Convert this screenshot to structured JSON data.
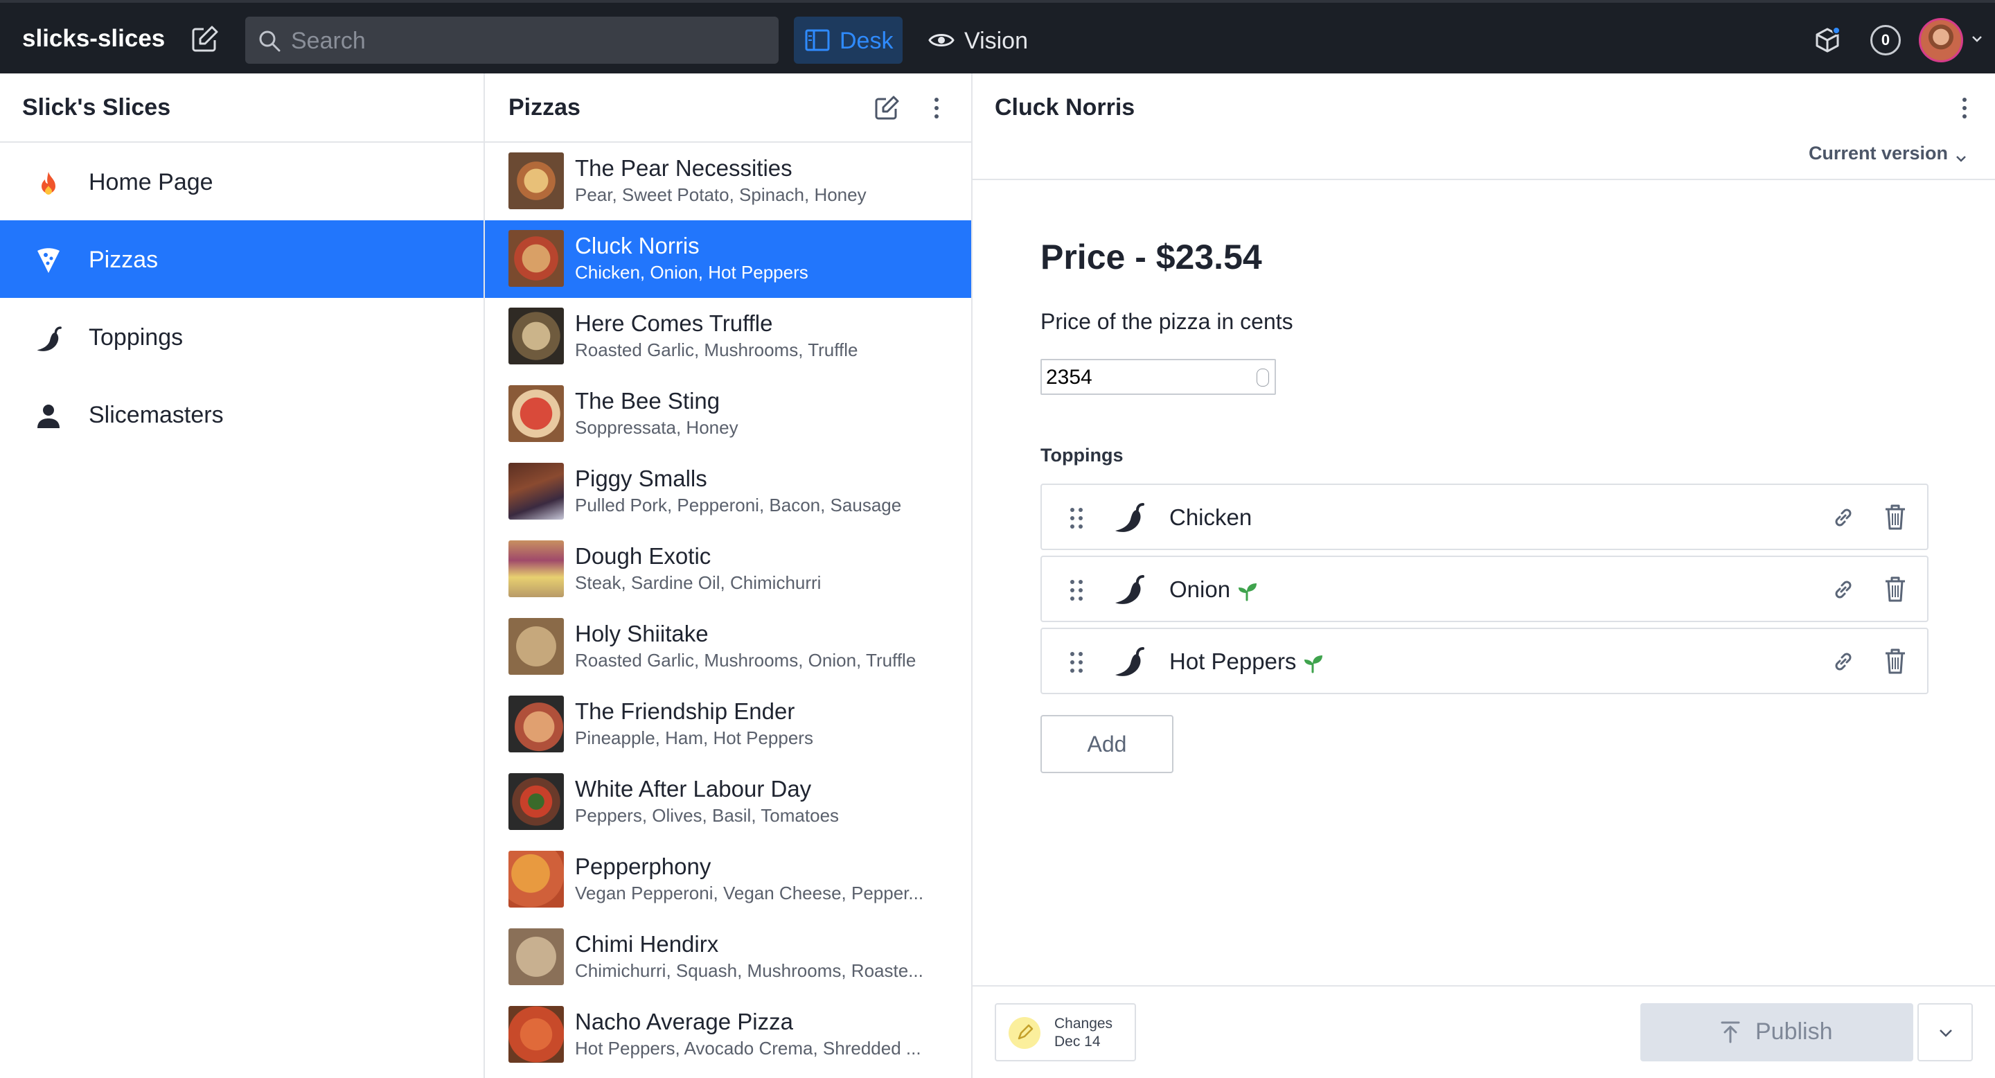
{
  "app": {
    "brand": "slicks-slices",
    "search_placeholder": "Search",
    "tabs": [
      {
        "label": "Desk",
        "active": true
      },
      {
        "label": "Vision",
        "active": false
      }
    ],
    "notification_count": "0",
    "colors": {
      "topbar": "#1b1f26",
      "accent": "#2276fc"
    }
  },
  "structure": {
    "title": "Slick's Slices",
    "items": [
      {
        "label": "Home Page",
        "icon": "fire-icon"
      },
      {
        "label": "Pizzas",
        "icon": "pizza-icon"
      },
      {
        "label": "Toppings",
        "icon": "chili-icon"
      },
      {
        "label": "Slicemasters",
        "icon": "person-icon"
      }
    ]
  },
  "list": {
    "title": "Pizzas",
    "items": [
      {
        "title": "The Pear Necessities",
        "subtitle": "Pear, Sweet Potato, Spinach, Honey"
      },
      {
        "title": "Cluck Norris",
        "subtitle": "Chicken, Onion, Hot Peppers"
      },
      {
        "title": "Here Comes Truffle",
        "subtitle": "Roasted Garlic, Mushrooms, Truffle"
      },
      {
        "title": "The Bee Sting",
        "subtitle": "Soppressata, Honey"
      },
      {
        "title": "Piggy Smalls",
        "subtitle": "Pulled Pork, Pepperoni, Bacon, Sausage"
      },
      {
        "title": "Dough Exotic",
        "subtitle": "Steak, Sardine Oil, Chimichurri"
      },
      {
        "title": "Holy Shiitake",
        "subtitle": "Roasted Garlic, Mushrooms, Onion, Truffle"
      },
      {
        "title": "The Friendship Ender",
        "subtitle": "Pineapple, Ham, Hot Peppers"
      },
      {
        "title": "White After Labour Day",
        "subtitle": "Peppers, Olives, Basil, Tomatoes"
      },
      {
        "title": "Pepperphony",
        "subtitle": "Vegan Pepperoni, Vegan Cheese, Pepper..."
      },
      {
        "title": "Chimi Hendirx",
        "subtitle": "Chimichurri, Squash, Mushrooms, Roaste..."
      },
      {
        "title": "Nacho Average Pizza",
        "subtitle": "Hot Peppers, Avocado Crema, Shredded ..."
      }
    ]
  },
  "editor": {
    "title": "Cluck Norris",
    "version_label": "Current version",
    "price_heading": "Price - $23.54",
    "price_description": "Price of the pizza in cents",
    "price_value": "2354",
    "toppings_label": "Toppings",
    "toppings": [
      {
        "name": "Chicken",
        "vegetarian": false
      },
      {
        "name": "Onion",
        "vegetarian": true
      },
      {
        "name": "Hot Peppers",
        "vegetarian": true
      }
    ],
    "add_label": "Add",
    "changes_label": "Changes",
    "changes_date": "Dec 14",
    "publish_label": "Publish"
  }
}
